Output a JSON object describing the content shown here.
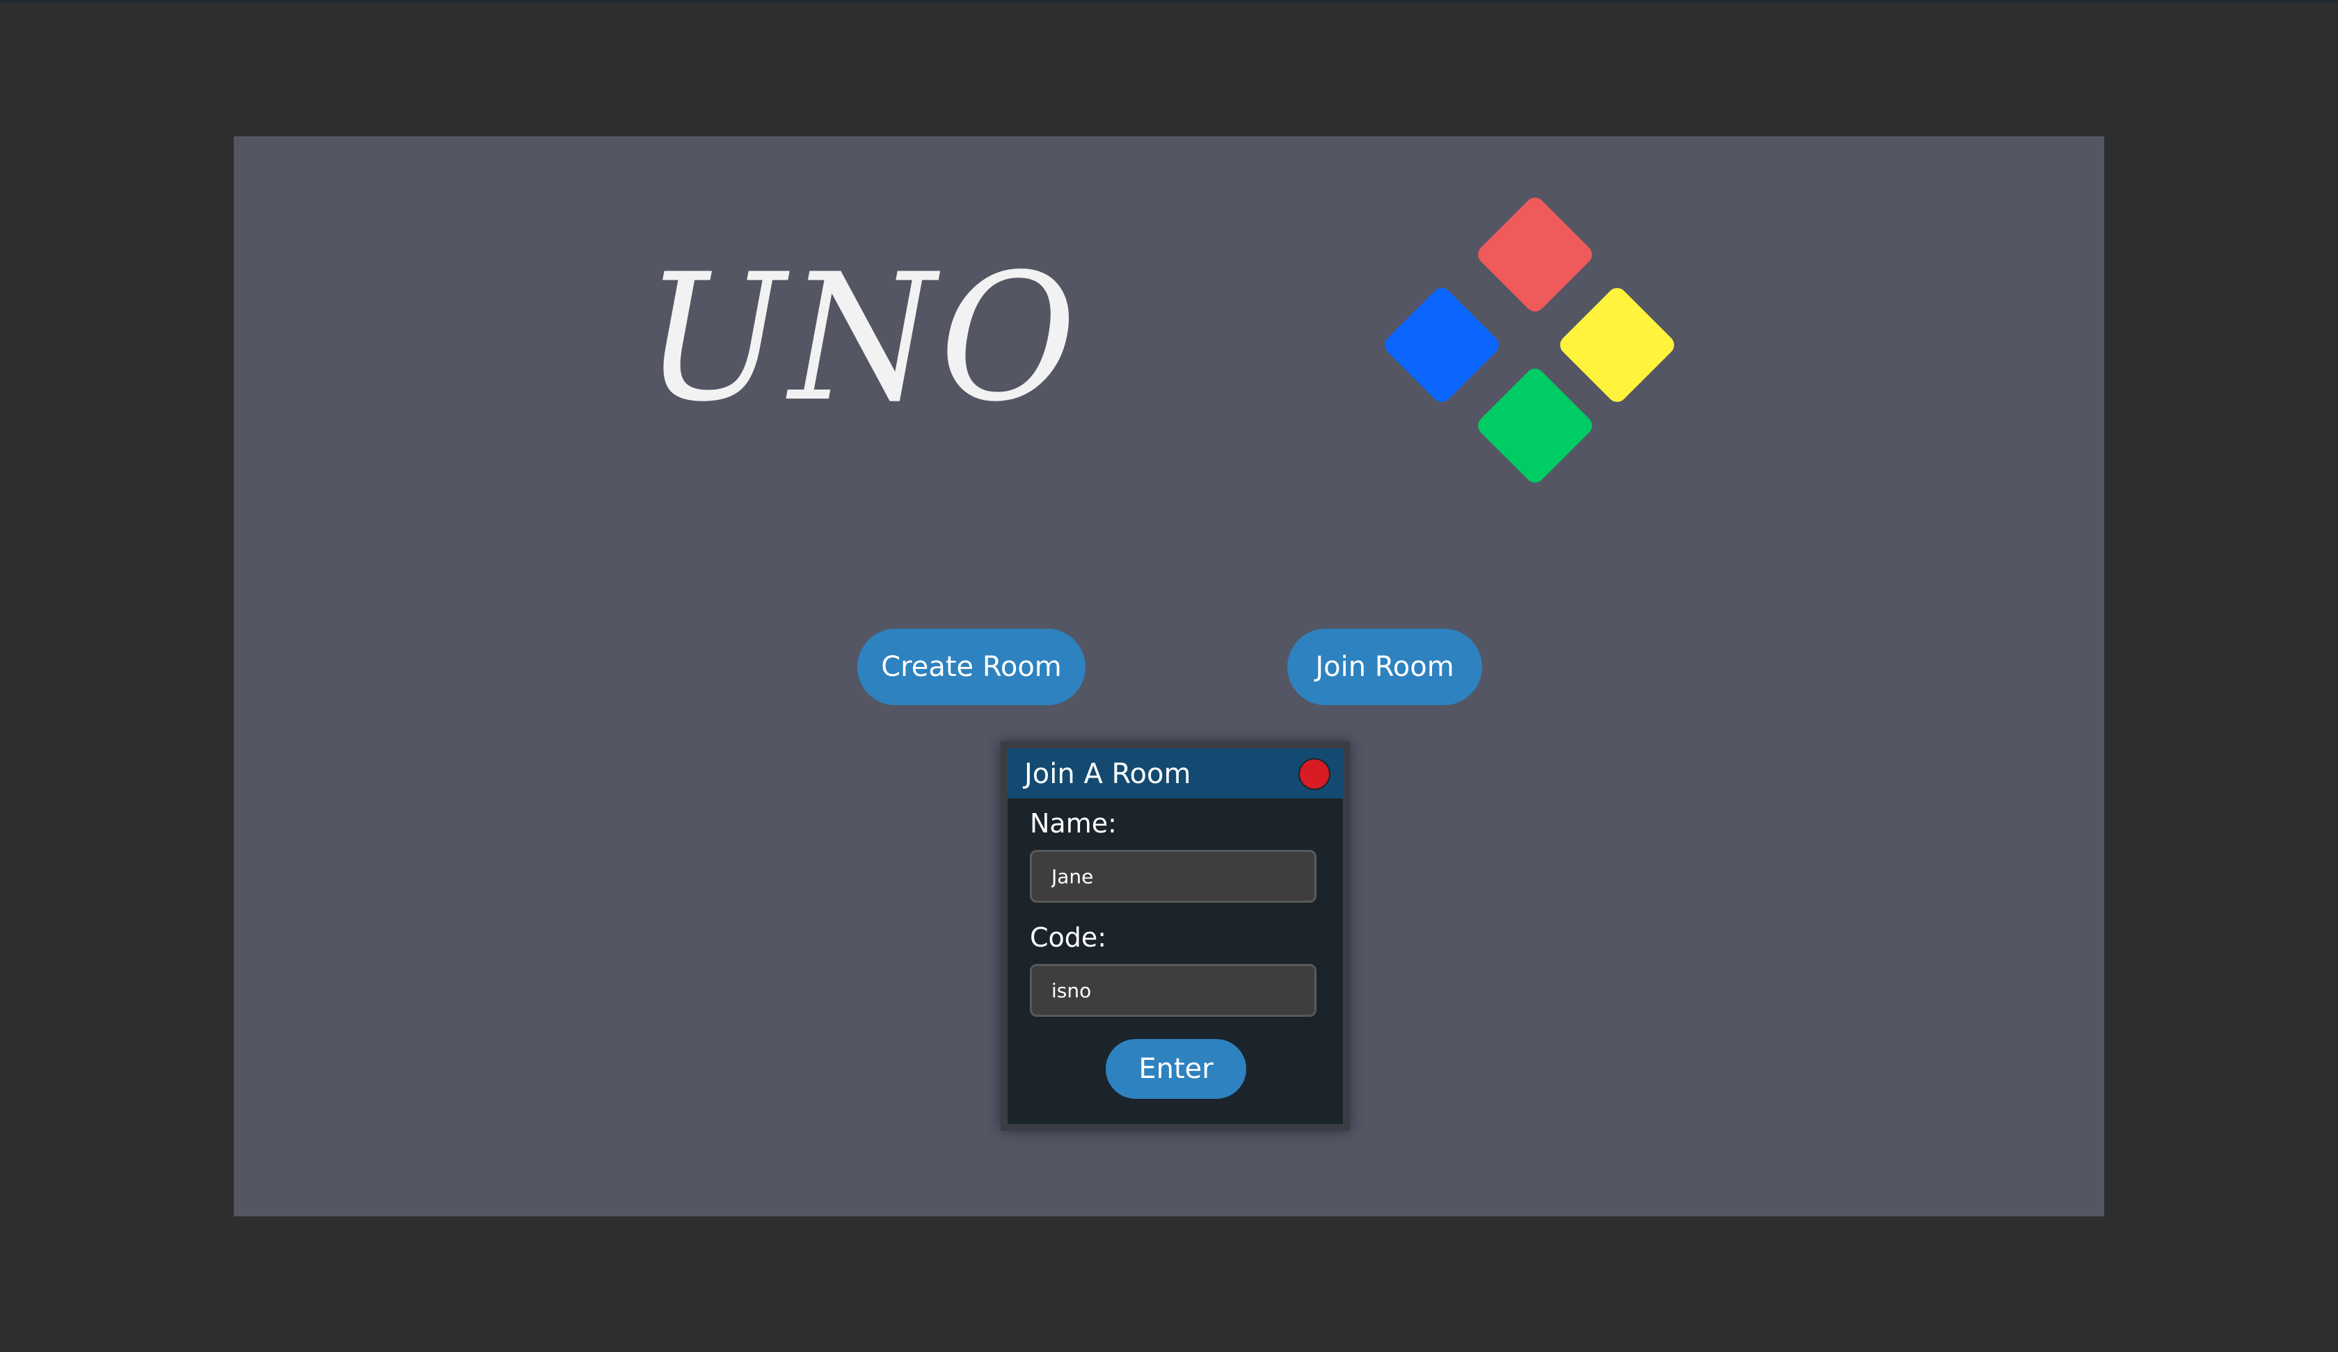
{
  "app": {
    "title": "UNO"
  },
  "logo": {
    "icon": "uno-diamond-logo-icon",
    "colors": {
      "red": "#ef5a5a",
      "blue": "#0a66ff",
      "yellow": "#fff33c",
      "green": "#00cc66"
    }
  },
  "actions": {
    "create_room_label": "Create Room",
    "join_room_label": "Join Room"
  },
  "modal": {
    "title": "Join A Room",
    "close_icon": "close-icon",
    "name_label": "Name:",
    "name_value": "Jane",
    "code_label": "Code:",
    "code_value": "isno",
    "enter_label": "Enter"
  },
  "colors": {
    "page_bg": "#2e2e2e",
    "stage_bg": "#545664",
    "button_bg": "#2e82bf",
    "modal_bg": "#1b242b",
    "modal_header_bg": "#144a72",
    "close_button": "#d81c24"
  }
}
